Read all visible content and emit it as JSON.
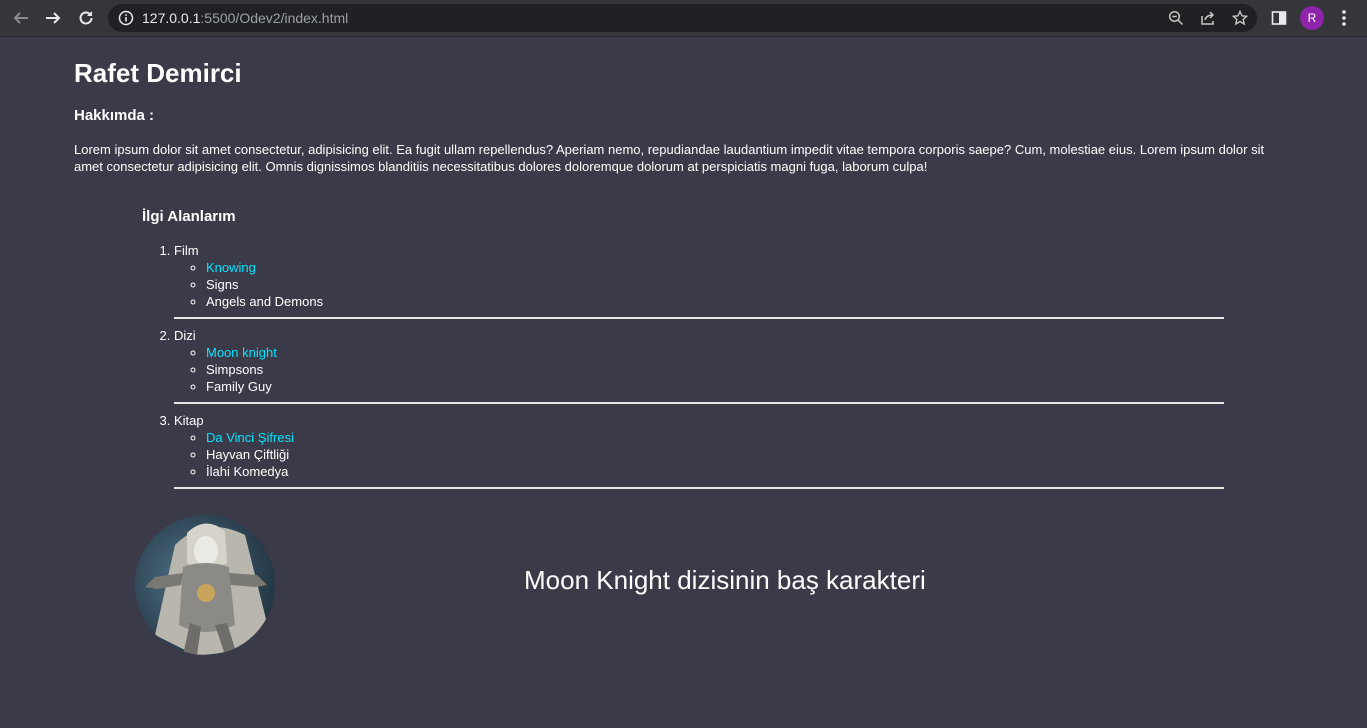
{
  "browser": {
    "url_host": "127.0.0.1",
    "url_rest": ":5500/Odev2/index.html",
    "profile_initial": "R",
    "icons": [
      "back-icon",
      "forward-icon",
      "reload-icon",
      "info-icon",
      "zoom-icon",
      "share-icon",
      "star-icon",
      "side-panel-icon",
      "menu-icon"
    ]
  },
  "page": {
    "name": "Rafet Demirci",
    "about_title": "Hakkımda :",
    "about_text": "Lorem ipsum dolor sit amet consectetur, adipisicing elit. Ea fugit ullam repellendus? Aperiam nemo, repudiandae laudantium impedit vitae tempora corporis saepe? Cum, molestiae eius. Lorem ipsum dolor sit amet consectetur adipisicing elit. Omnis dignissimos blanditiis necessitatibus dolores doloremque dolorum at perspiciatis magni fuga, laborum culpa!",
    "interests_title": "İlgi Alanlarım",
    "categories": [
      {
        "label": "Film",
        "items": [
          "Knowing",
          "Signs",
          "Angels and Demons"
        ]
      },
      {
        "label": "Dizi",
        "items": [
          "Moon knight",
          "Simpsons",
          "Family Guy"
        ]
      },
      {
        "label": "Kitap",
        "items": [
          "Da Vinci Şifresi",
          "Hayvan Çiftliği",
          "İlahi Komedya"
        ]
      }
    ],
    "caption": "Moon Knight dizisinin baş karakteri"
  },
  "colors": {
    "background": "#3b3a48",
    "link": "#00e5ff",
    "text": "#ffffff",
    "avatar": "#8e24aa"
  }
}
